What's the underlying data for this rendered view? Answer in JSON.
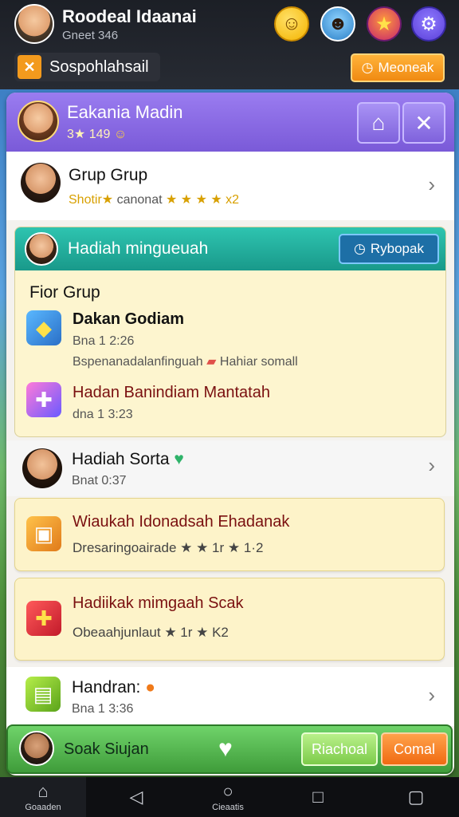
{
  "header": {
    "player_name": "Roodeal Idaanai",
    "player_sub": "Gneet 346",
    "quest_label": "Sospohlahsail",
    "quest_button": "Meoneak"
  },
  "profile": {
    "name": "Eakania Madin",
    "sub": "3★ 149"
  },
  "group_row": {
    "title": "Grup Grup",
    "sub_prefix": "Shotir★",
    "sub_text": "canonat",
    "sub_suffix": "★ ★ ★ ★ x2"
  },
  "weekly_gift": {
    "title": "Hadiah mingueuah",
    "button": "Rybopak",
    "section_label": "Fior Grup",
    "items": [
      {
        "title": "Dakan Godiam",
        "time": "Bna 1 2:26",
        "note": "Bspenanadalanfinguah",
        "note_tag": "Hahiar somall"
      },
      {
        "title": "Hadan Banindiam Mantatah",
        "time": "dna 1 3:23"
      }
    ]
  },
  "row_sorta": {
    "title": "Hadiah Sorta",
    "sub": "Bnat 0:37"
  },
  "cards": [
    {
      "title": "Wiaukah Idonadsah Ehadanak",
      "sub": "Dresaringoairade ★ ★ 1r ★ 1·2"
    },
    {
      "title": "Hadiikak mimgaah Scak",
      "sub": "Obeaahjunlaut ★ 1r ★ K2"
    }
  ],
  "row_handran": {
    "title": "Handran:",
    "sub": "Bna 1 3:36"
  },
  "bottom_action": {
    "label": "Soak Siujan",
    "button_green": "Riachoal",
    "button_orange": "Comal"
  },
  "navbar": {
    "home_label": "Goaaden",
    "center_label": "Cieaatis"
  },
  "colors": {
    "header_purple": "#7a5ad8",
    "teal": "#19998a",
    "orange": "#f08a12",
    "green": "#3f9c3a",
    "gold": "#d8a000"
  }
}
